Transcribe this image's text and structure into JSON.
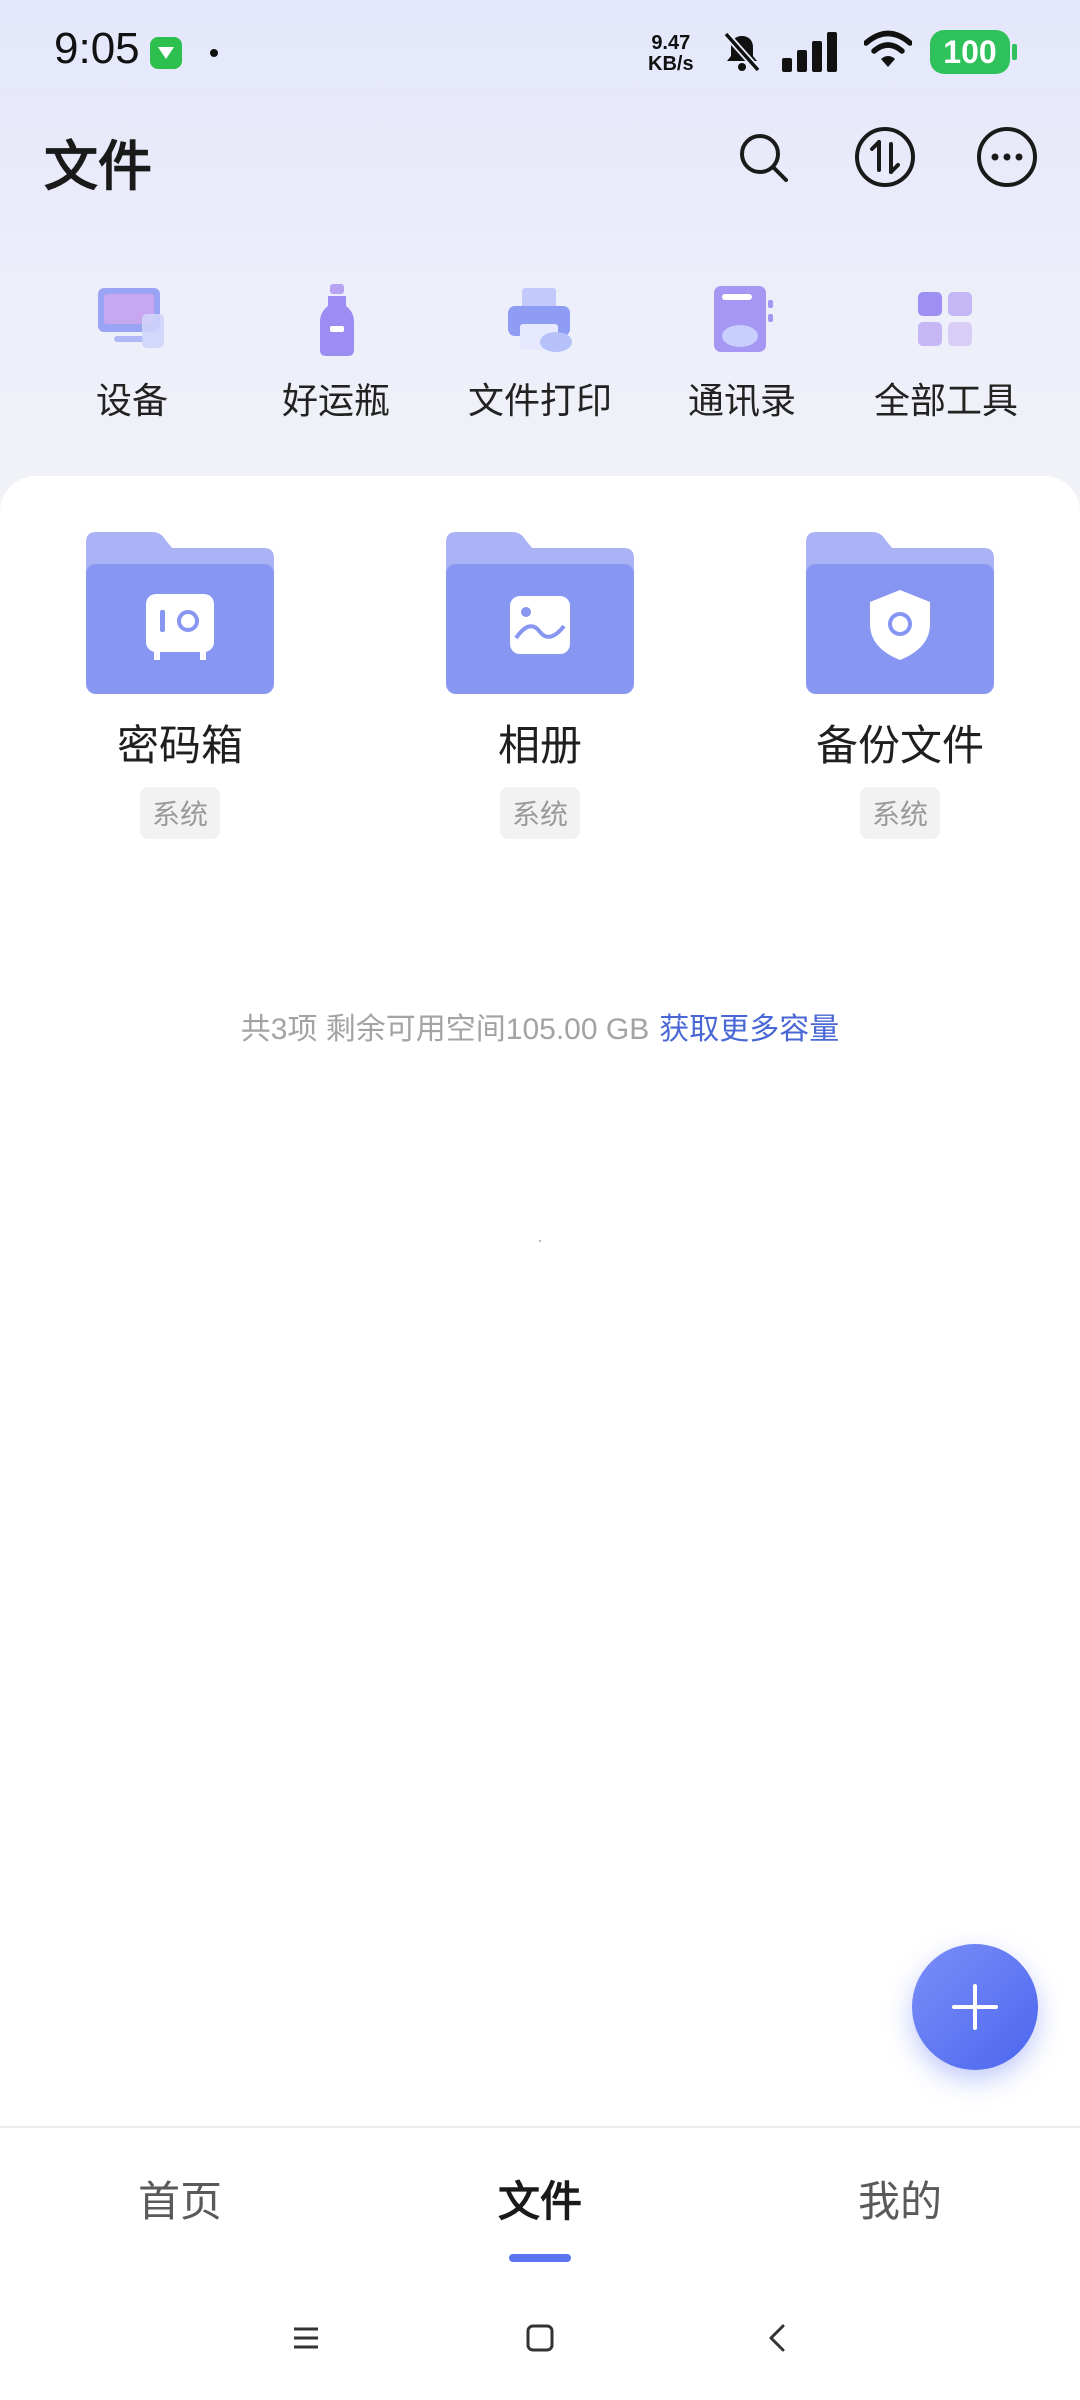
{
  "status_bar": {
    "time": "9:05",
    "net_speed_value": "9.47",
    "net_speed_unit": "KB/s",
    "battery": "100",
    "icons": [
      "app-notification-icon",
      "bell-muted-icon",
      "signal-icon",
      "wifi-icon",
      "battery-icon"
    ]
  },
  "header": {
    "title": "文件",
    "actions": [
      "search-icon",
      "transfer-icon",
      "more-icon"
    ]
  },
  "tools": [
    {
      "label": "设备",
      "icon": "device-icon"
    },
    {
      "label": "好运瓶",
      "icon": "bottle-icon"
    },
    {
      "label": "文件打印",
      "icon": "printer-icon"
    },
    {
      "label": "通讯录",
      "icon": "contacts-icon"
    },
    {
      "label": "全部工具",
      "icon": "all-tools-icon"
    }
  ],
  "folders": [
    {
      "name": "密码箱",
      "tag": "系统",
      "icon": "safe-folder-icon"
    },
    {
      "name": "相册",
      "tag": "系统",
      "icon": "album-folder-icon"
    },
    {
      "name": "备份文件",
      "tag": "系统",
      "icon": "backup-folder-icon"
    }
  ],
  "summary": {
    "text": "共3项 剩余可用空间105.00 GB",
    "link": "获取更多容量"
  },
  "bottom_nav": {
    "tabs": [
      "首页",
      "文件",
      "我的"
    ],
    "active": "文件"
  },
  "colors": {
    "accent": "#5b73f0",
    "link": "#4a67d6",
    "battery": "#2fc25b"
  }
}
